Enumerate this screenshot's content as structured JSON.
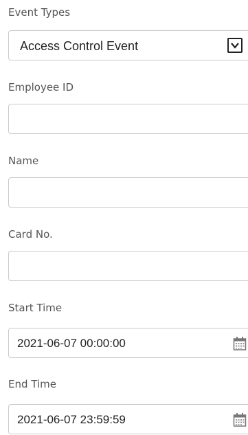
{
  "form": {
    "event_types": {
      "label": "Event Types",
      "selected": "Access Control Event",
      "icon": "chevron-down-icon"
    },
    "employee_id": {
      "label": "Employee ID",
      "value": ""
    },
    "name": {
      "label": "Name",
      "value": ""
    },
    "card_no": {
      "label": "Card No.",
      "value": ""
    },
    "start_time": {
      "label": "Start Time",
      "value": "2021-06-07 00:00:00",
      "icon": "calendar-icon"
    },
    "end_time": {
      "label": "End Time",
      "value": "2021-06-07 23:59:59",
      "icon": "calendar-icon"
    }
  },
  "colors": {
    "border": "#c9c9c9",
    "label_text": "#555555",
    "value_text": "#222222"
  }
}
